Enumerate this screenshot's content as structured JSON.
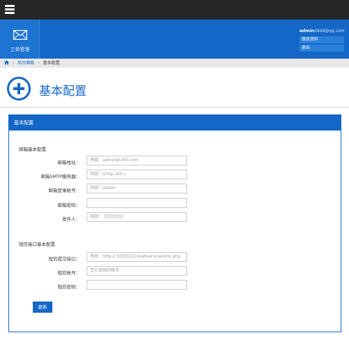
{
  "topbar": {
    "menu_icon": "hamburger-icon"
  },
  "nav": {
    "tile_icon": "envelope-icon",
    "tile_label": "工单管理"
  },
  "user": {
    "name": "admin",
    "domain": "dddd@qq.com",
    "menu": [
      "修改资料",
      "退出"
    ]
  },
  "breadcrumb": {
    "home_icon": "home-icon",
    "items": [
      "后台面板",
      "基本配置"
    ]
  },
  "header": {
    "icon": "plus-circle-icon",
    "title": "基本配置"
  },
  "panel": {
    "title": "基本配置"
  },
  "mail": {
    "section": "邮箱基本配置",
    "fields": [
      {
        "label": "邮箱地址：",
        "placeholder": "例如：admin@163.com"
      },
      {
        "label": "邮箱SMTP服务器：",
        "placeholder": "例如：smtp.163.c"
      },
      {
        "label": "邮箱登录帐号：",
        "placeholder": "例如：admin"
      },
      {
        "label": "邮箱密码：",
        "placeholder": ""
      },
      {
        "label": "发件人：",
        "placeholder": "例如："
      }
    ]
  },
  "sms": {
    "section": "短信接口基本配置",
    "fields": [
      {
        "label": "短信提交接口：",
        "placeholder_a": "例如：http://",
        "placeholder_b": "/webservice/sms.php"
      },
      {
        "label": "短信帐号：",
        "placeholder": "互亿无线的帐号"
      },
      {
        "label": "短信密码：",
        "placeholder": ""
      }
    ]
  },
  "actions": {
    "submit": "更新"
  },
  "colors": {
    "primary": "#1467c6",
    "topbar": "#262626",
    "breadcrumb_bg": "#e8e8e8"
  }
}
